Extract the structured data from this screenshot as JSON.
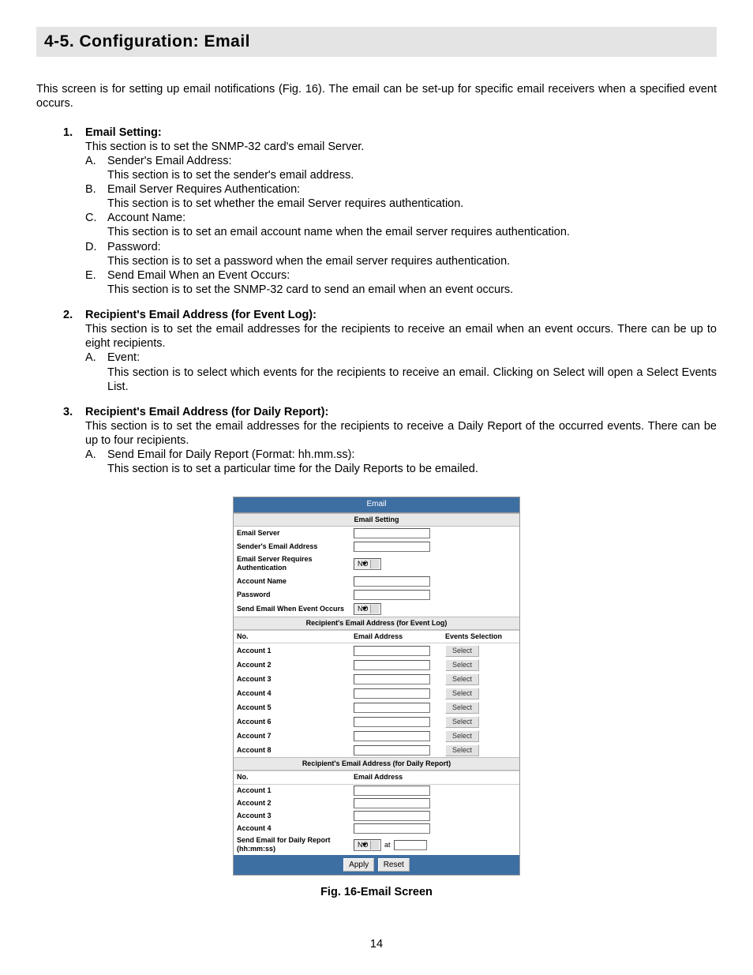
{
  "title": "4-5.  Configuration: Email",
  "intro": "This screen is for setting up email notifications (Fig. 16).  The email can be set-up for specific email receivers when a specified event occurs.",
  "items": [
    {
      "num": "1.",
      "head": "Email Setting:",
      "desc": "This section is to set the SNMP-32 card's email Server.",
      "subs": [
        {
          "letter": "A.",
          "head": "Sender's Email Address:",
          "desc": "This section is to set the sender's email address."
        },
        {
          "letter": "B.",
          "head": "Email Server Requires Authentication:",
          "desc": "This section is to set whether the email Server requires authentication."
        },
        {
          "letter": "C.",
          "head": "Account Name:",
          "desc": "This section is to set an email account name when the email server requires authentication."
        },
        {
          "letter": "D.",
          "head": "Password:",
          "desc": "This section is to set a password when the email server requires authentication."
        },
        {
          "letter": "E.",
          "head": "Send Email When an Event Occurs:",
          "desc": "This section is to set the SNMP-32 card to send an email when an event occurs."
        }
      ]
    },
    {
      "num": "2.",
      "head": "Recipient's Email Address (for Event Log):",
      "desc": "This section is to set the email addresses for the recipients to receive an email when an event occurs.  There can be up to eight recipients.",
      "subs": [
        {
          "letter": "A.",
          "head": "Event:",
          "desc": "This section is to select which events for the recipients to receive an email.  Clicking on Select will open a Select Events List."
        }
      ]
    },
    {
      "num": "3.",
      "head": "Recipient's Email Address (for Daily Report):",
      "desc": "This section is to set the email addresses for the recipients to receive a Daily Report of the occurred events.  There can be up to four recipients.",
      "subs": [
        {
          "letter": "A.",
          "head": "Send Email for Daily Report (Format:  hh.mm.ss):",
          "desc": "This section is to set a particular time for the Daily Reports to be emailed."
        }
      ]
    }
  ],
  "fig": {
    "header": "Email",
    "sec1": "Email Setting",
    "rows1": [
      {
        "label": "Email Server",
        "type": "text"
      },
      {
        "label": "Sender's Email Address",
        "type": "text"
      },
      {
        "label": "Email Server Requires Authentication",
        "type": "select",
        "value": "NO"
      },
      {
        "label": "Account Name",
        "type": "text"
      },
      {
        "label": "Password",
        "type": "text"
      },
      {
        "label": "Send Email When Event Occurs",
        "type": "select",
        "value": "NO"
      }
    ],
    "sec2": "Recipient's Email Address (for Event Log)",
    "cols2": {
      "no": "No.",
      "email": "Email Address",
      "sel": "Events Selection"
    },
    "rows2": [
      "Account 1",
      "Account 2",
      "Account 3",
      "Account 4",
      "Account 5",
      "Account 6",
      "Account 7",
      "Account 8"
    ],
    "select_btn": "Select",
    "sec3": "Recipient's Email Address (for Daily Report)",
    "cols3": {
      "no": "No.",
      "email": "Email Address"
    },
    "rows3": [
      "Account 1",
      "Account 2",
      "Account 3",
      "Account 4"
    ],
    "daily": {
      "label": "Send Email for Daily Report (hh:mm:ss)",
      "value": "NO",
      "at": "at"
    },
    "apply": "Apply",
    "reset": "Reset",
    "caption": "Fig. 16-Email Screen"
  },
  "page_number": "14"
}
